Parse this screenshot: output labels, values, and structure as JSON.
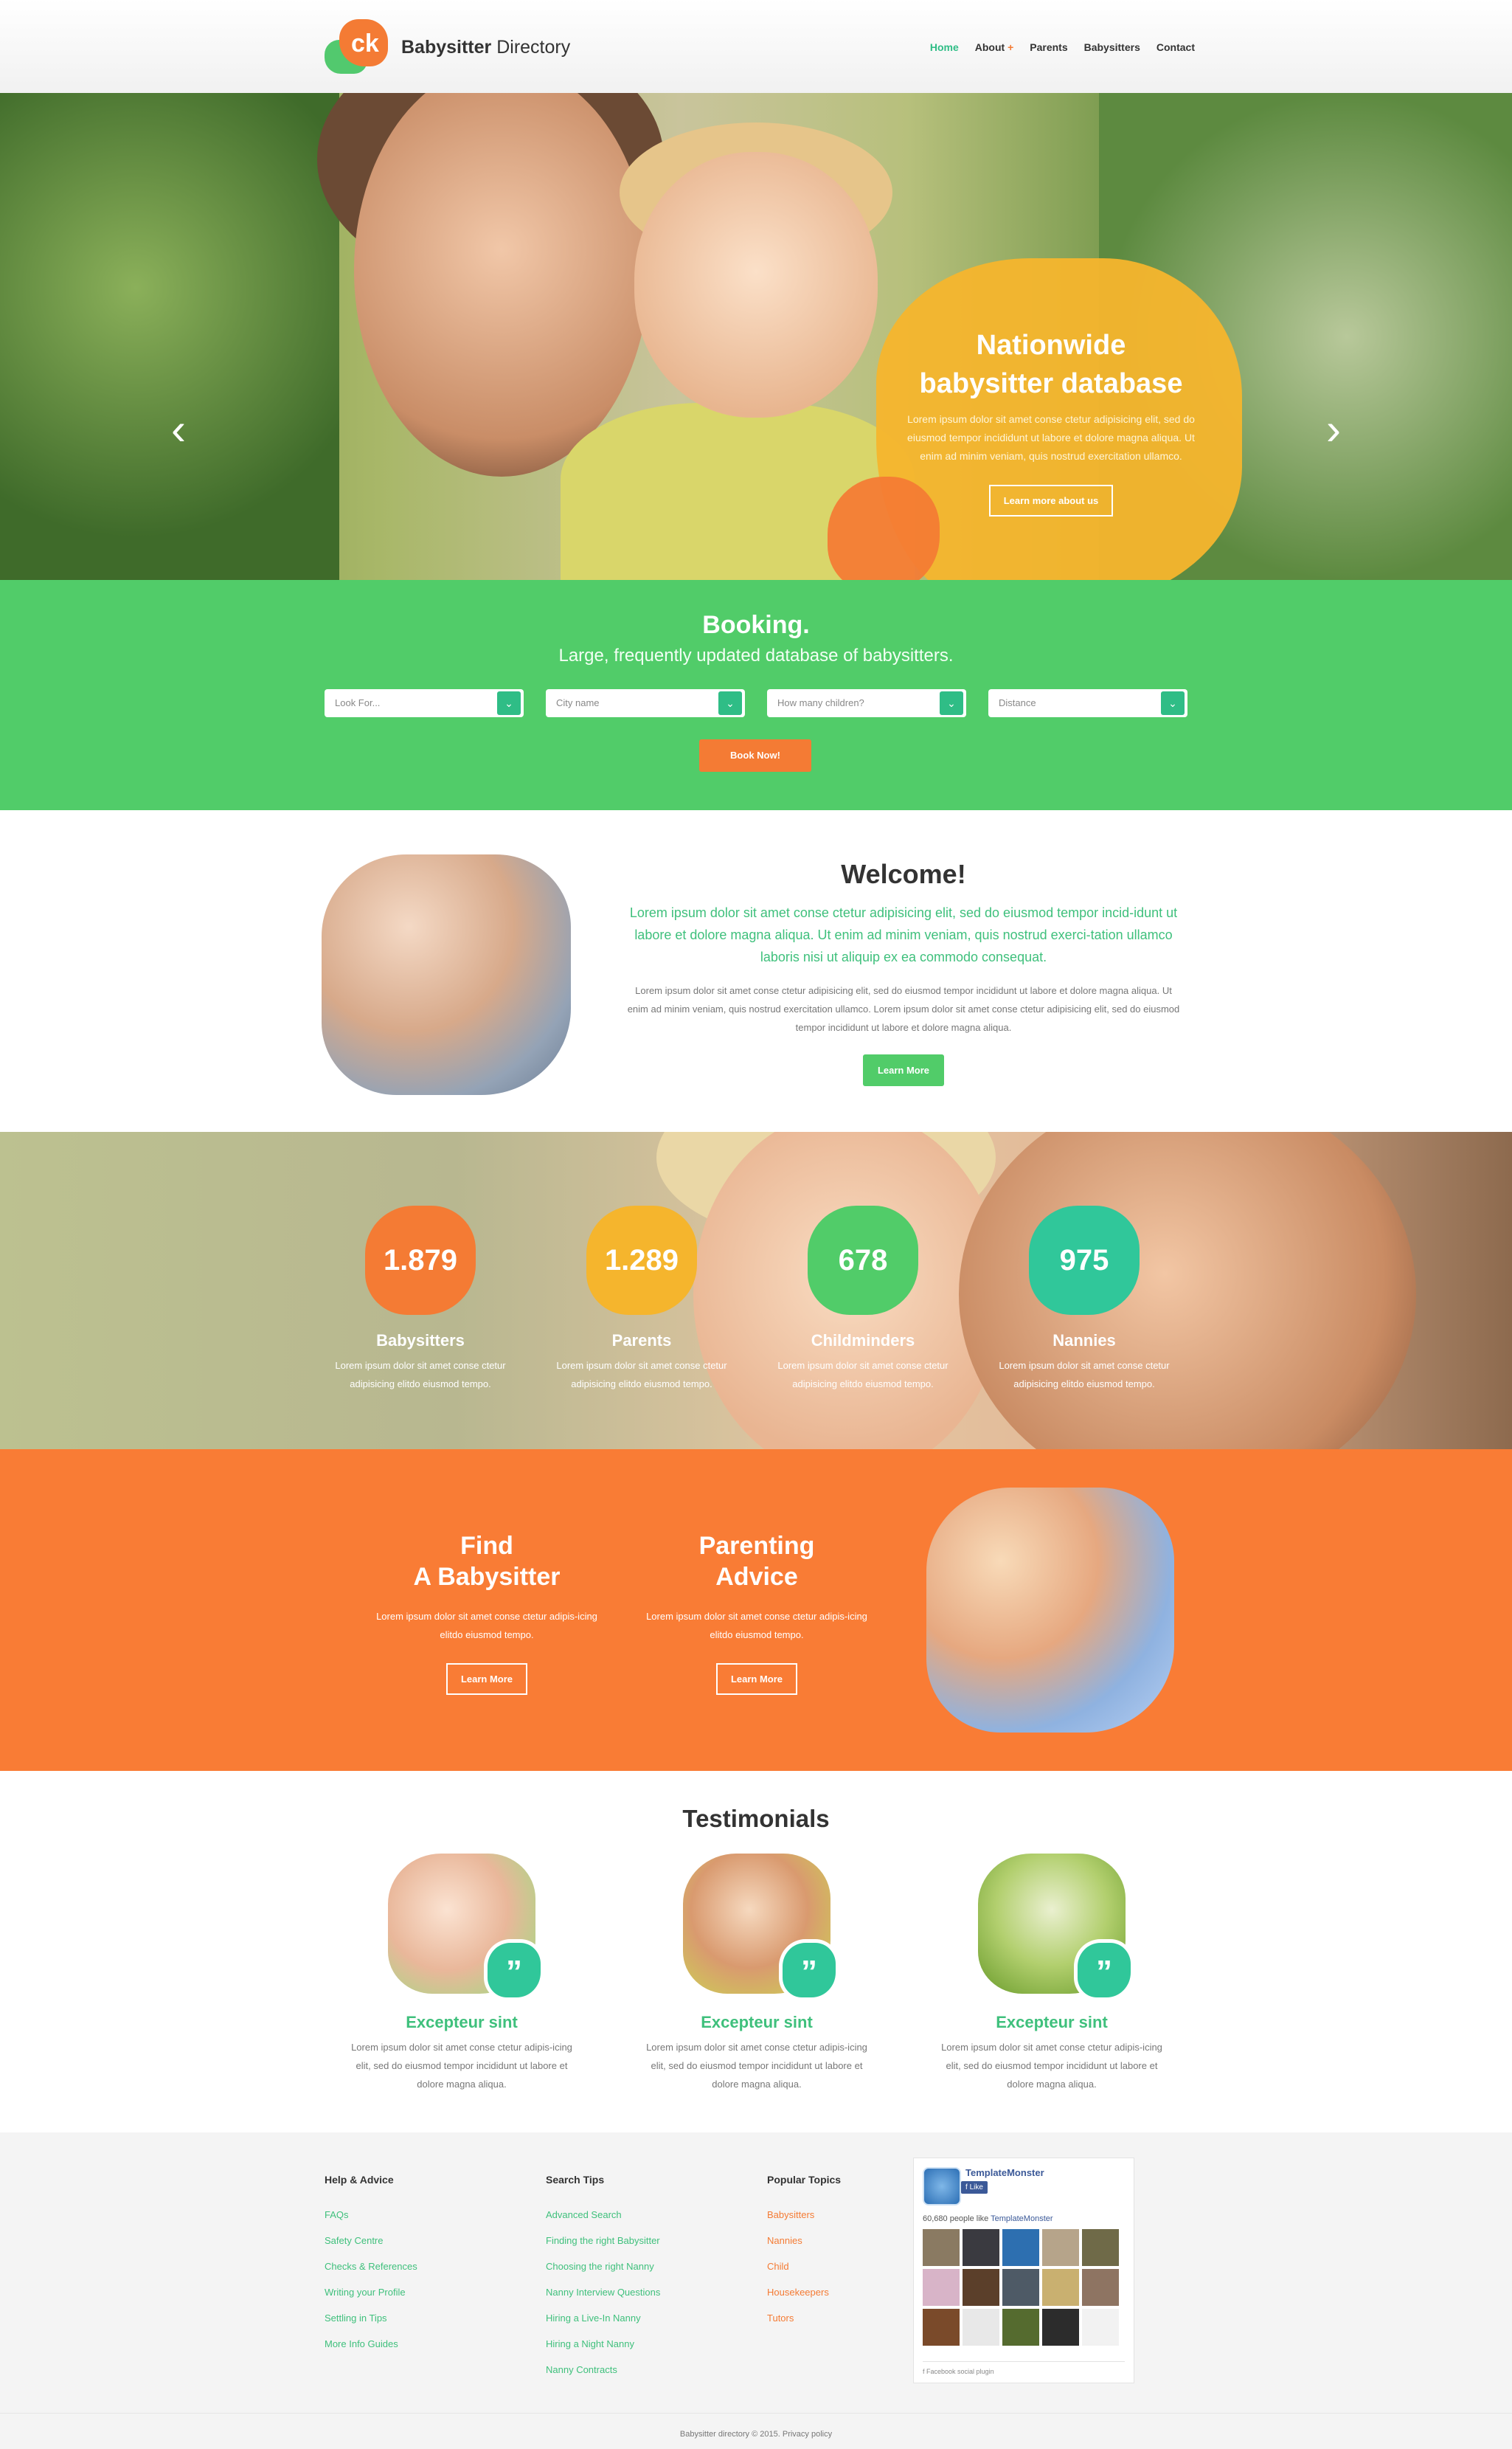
{
  "header": {
    "logo_text_bold": "Babysitter",
    "logo_text_rest": " Directory",
    "nav": [
      {
        "label": "Home",
        "active": true
      },
      {
        "label": "About",
        "plus": "+"
      },
      {
        "label": "Parents"
      },
      {
        "label": "Babysitters"
      },
      {
        "label": "Contact"
      }
    ]
  },
  "hero": {
    "title_line1": "Nationwide",
    "title_line2": "babysitter database",
    "text": "Lorem ipsum dolor sit amet conse ctetur adipisicing elit, sed do eiusmod tempor incididunt ut labore et dolore magna aliqua. Ut enim ad minim veniam, quis nostrud exercitation ullamco.",
    "button": "Learn more about us",
    "prev_icon": "‹",
    "next_icon": "›"
  },
  "booking": {
    "title": "Booking.",
    "subtitle": "Large, frequently updated database of babysitters.",
    "selects": [
      "Look For...",
      "City name",
      "How many children?",
      "Distance"
    ],
    "button": "Book Now!"
  },
  "welcome": {
    "title": "Welcome!",
    "lead": "Lorem ipsum dolor sit amet conse ctetur adipisicing elit, sed do eiusmod tempor incid-idunt ut labore et dolore magna aliqua. Ut enim ad minim veniam, quis nostrud exerci-tation ullamco laboris nisi ut aliquip ex ea commodo consequat.",
    "body": "Lorem ipsum dolor sit amet conse ctetur adipisicing elit, sed do eiusmod tempor incididunt ut labore et dolore magna aliqua. Ut enim ad minim veniam, quis nostrud exercitation ullamco. Lorem ipsum dolor sit amet conse ctetur adipisicing elit, sed do eiusmod tempor incididunt ut labore et dolore magna aliqua.",
    "button": "Learn More"
  },
  "stats": [
    {
      "num": "1.879",
      "label": "Babysitters",
      "desc": "Lorem ipsum dolor sit amet conse ctetur adipisicing elitdo eiusmod tempo.",
      "color": "#f47b34"
    },
    {
      "num": "1.289",
      "label": "Parents",
      "desc": "Lorem ipsum dolor sit amet conse ctetur adipisicing elitdo eiusmod tempo.",
      "color": "#f5b52d"
    },
    {
      "num": "678",
      "label": "Childminders",
      "desc": "Lorem ipsum dolor sit amet conse ctetur adipisicing elitdo eiusmod tempo.",
      "color": "#51cc69"
    },
    {
      "num": "975",
      "label": "Nannies",
      "desc": "Lorem ipsum dolor sit amet conse ctetur adipisicing elitdo eiusmod tempo.",
      "color": "#30c79a"
    }
  ],
  "features": [
    {
      "title_line1": "Find",
      "title_line2": "A Babysitter",
      "text": "Lorem ipsum dolor sit amet conse ctetur adipis-icing elitdo eiusmod tempo.",
      "button": "Learn More"
    },
    {
      "title_line1": "Parenting",
      "title_line2": "Advice",
      "text": "Lorem ipsum dolor sit amet conse ctetur adipis-icing elitdo eiusmod tempo.",
      "button": "Learn More"
    }
  ],
  "testimonials": {
    "title": "Testimonials",
    "quote_icon": "”",
    "items": [
      {
        "name": "Excepteur sint",
        "text": "Lorem ipsum dolor sit amet conse ctetur adipis-icing elit, sed do eiusmod tempor incididunt ut labore et dolore magna aliqua."
      },
      {
        "name": "Excepteur sint",
        "text": "Lorem ipsum dolor sit amet conse ctetur adipis-icing elit, sed do eiusmod tempor incididunt ut labore et dolore magna aliqua."
      },
      {
        "name": "Excepteur sint",
        "text": "Lorem ipsum dolor sit amet conse ctetur adipis-icing elit, sed do eiusmod tempor incididunt ut labore et dolore magna aliqua."
      }
    ]
  },
  "footer": {
    "col1": {
      "title": "Help & Advice",
      "links": [
        "FAQs",
        "Safety Centre",
        "Checks & References",
        "Writing your Profile",
        "Settling in Tips",
        "More Info Guides"
      ]
    },
    "col2": {
      "title": "Search Tips",
      "links": [
        "Advanced Search",
        "Finding the right Babysitter",
        "Choosing the right Nanny",
        "Nanny Interview Questions",
        "Hiring a Live-In Nanny",
        "Hiring a Night Nanny",
        "Nanny Contracts"
      ]
    },
    "col3": {
      "title": "Popular Topics",
      "links": [
        "Babysitters",
        "Nannies",
        "Child",
        "Housekeepers",
        "Tutors"
      ]
    },
    "facebook": {
      "page_name": "TemplateMonster",
      "like": "Like",
      "count_text": "60,680 people like ",
      "count_link": "TemplateMonster",
      "plugin": "Facebook social plugin"
    },
    "copyright": "Babysitter directory © 2015. Privacy policy"
  }
}
